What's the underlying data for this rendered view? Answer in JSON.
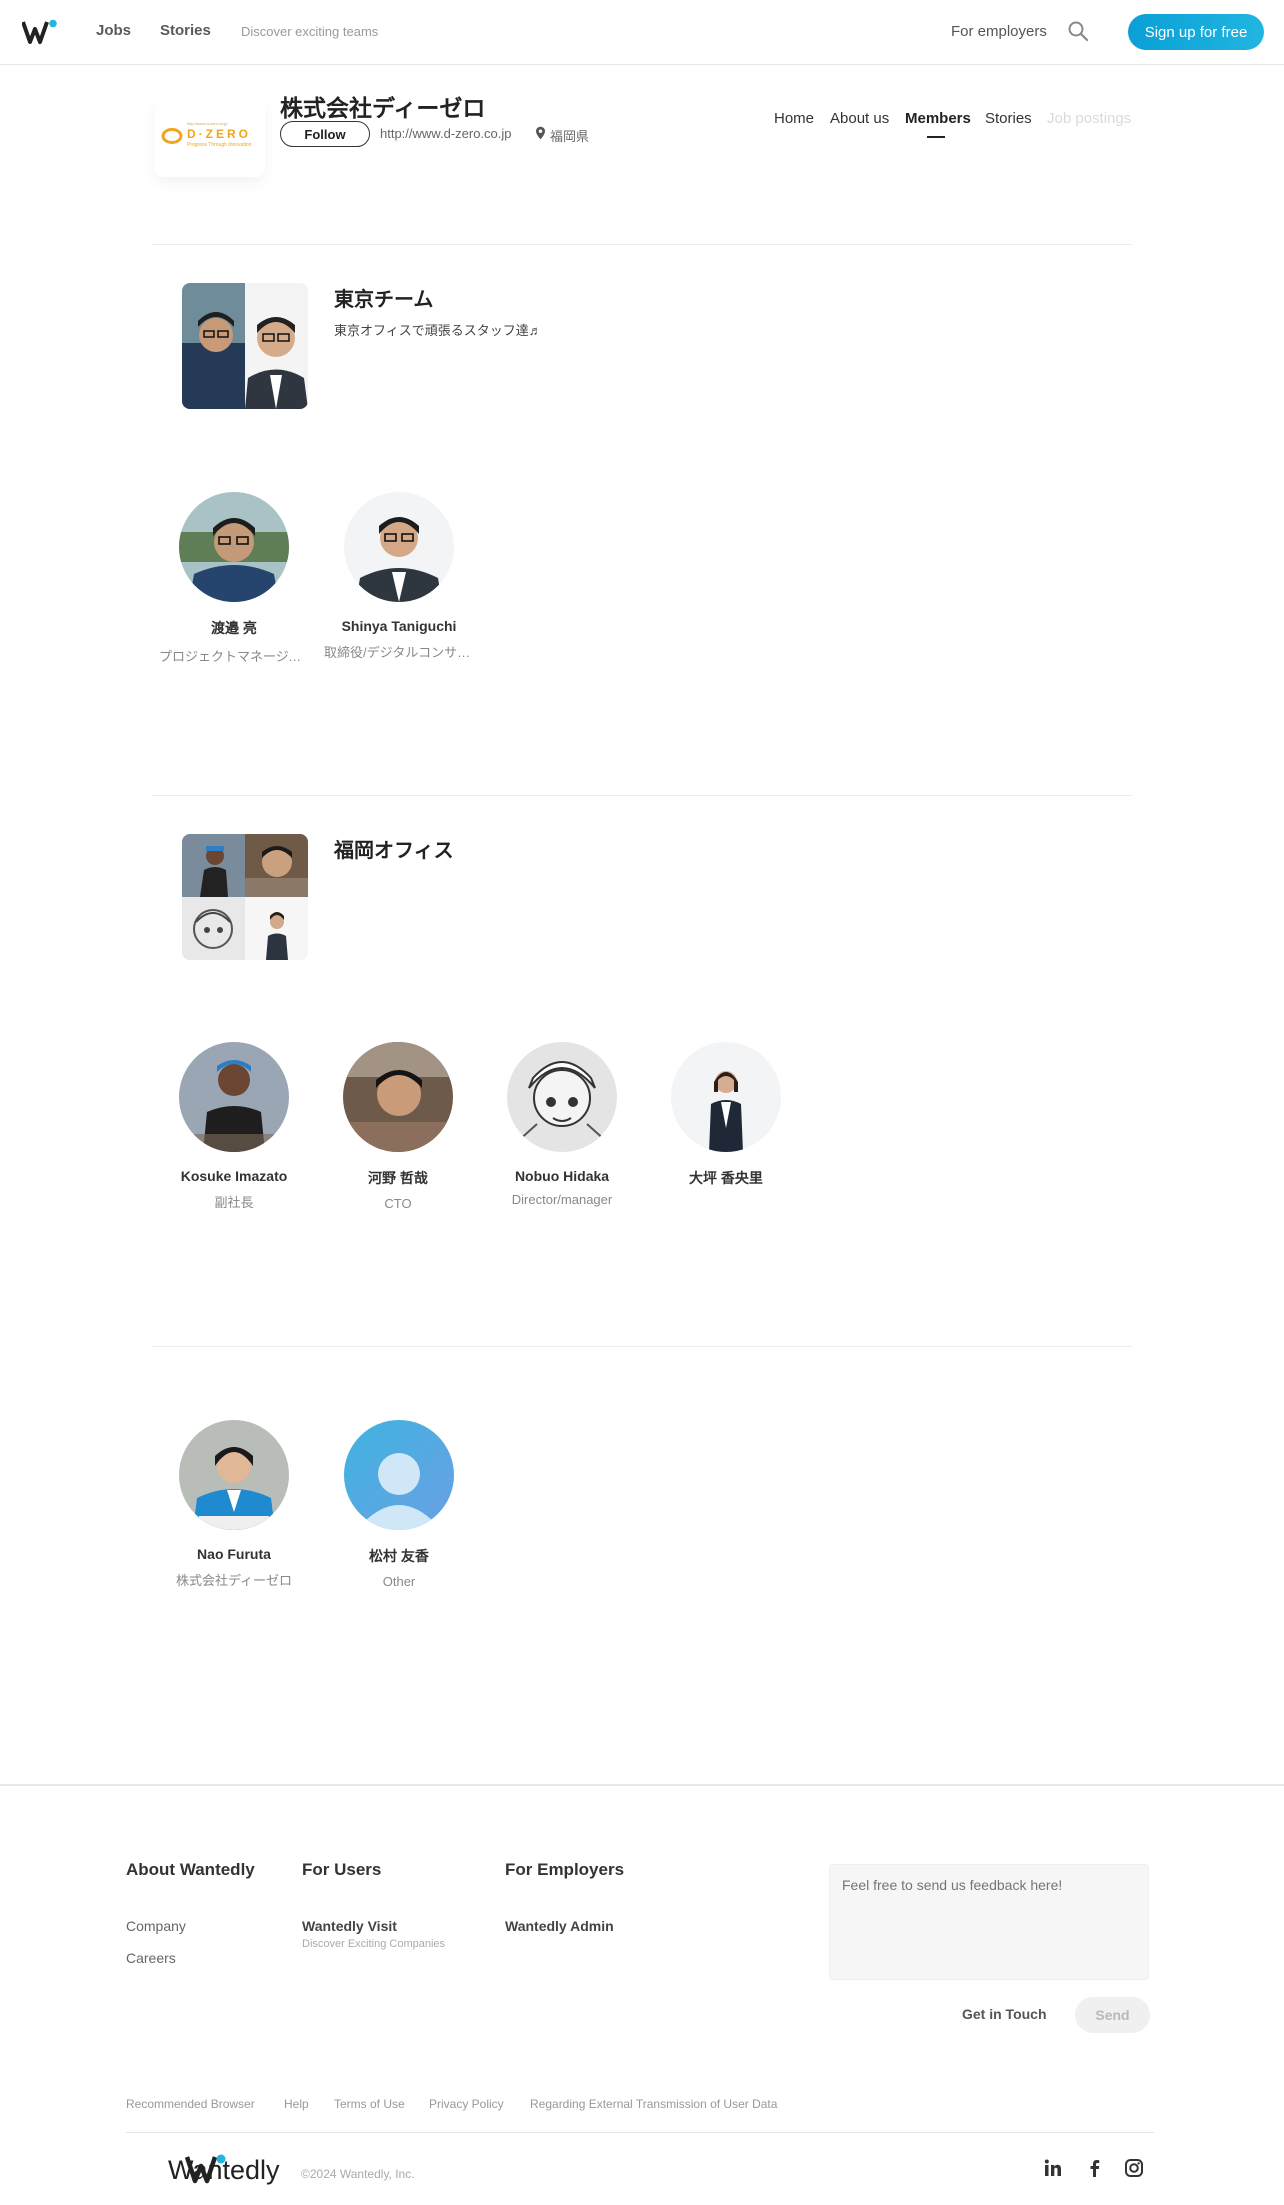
{
  "header": {
    "nav": {
      "jobs": "Jobs",
      "stories": "Stories",
      "discover": "Discover exciting teams"
    },
    "for_employers": "For employers",
    "signup": "Sign up for free"
  },
  "company": {
    "logo_text": "D·ZERO",
    "logo_tagline": "Progress Through Innovation",
    "logo_url": "http://www.d-zero.co.jp",
    "name": "株式会社ディーゼロ",
    "follow": "Follow",
    "url": "http://www.d-zero.co.jp",
    "location": "福岡県",
    "tabs": [
      "Home",
      "About us",
      "Members",
      "Stories",
      "Job postings"
    ]
  },
  "groups": [
    {
      "title": "東京チーム",
      "desc": "東京オフィスで頑張るスタッフ達♬",
      "members": [
        {
          "name": "渡邉 亮",
          "role": "プロジェクトマネージャー"
        },
        {
          "name": "Shinya Taniguchi",
          "role": "取締役/デジタルコンサルタント"
        }
      ]
    },
    {
      "title": "福岡オフィス",
      "desc": "",
      "members": [
        {
          "name": "Kosuke Imazato",
          "role": "副社長"
        },
        {
          "name": "河野 哲哉",
          "role": "CTO"
        },
        {
          "name": "Nobuo Hidaka",
          "role": "Director/manager"
        },
        {
          "name": "大坪 香央里",
          "role": ""
        }
      ]
    },
    {
      "members": [
        {
          "name": "Nao Furuta",
          "role": "株式会社ディーゼロ"
        },
        {
          "name": "松村 友香",
          "role": "Other"
        }
      ]
    }
  ],
  "footer": {
    "about": {
      "title": "About Wantedly",
      "links": [
        "Company",
        "Careers"
      ]
    },
    "users": {
      "title": "For Users",
      "link": "Wantedly Visit",
      "sub": "Discover Exciting Companies"
    },
    "employers": {
      "title": "For Employers",
      "link": "Wantedly Admin"
    },
    "feedback_placeholder": "Feel free to send us feedback here!",
    "get_in_touch": "Get in Touch",
    "send": "Send",
    "small_links": [
      "Recommended Browser",
      "Help",
      "Terms of Use",
      "Privacy Policy",
      "Regarding External Transmission of User Data"
    ],
    "brand": "Wantedly",
    "copyright": "©2024 Wantedly, Inc."
  },
  "colors": {
    "accent": "#14a8db",
    "logo_orange": "#f0a520",
    "logo_dot": "#21b5e0"
  }
}
